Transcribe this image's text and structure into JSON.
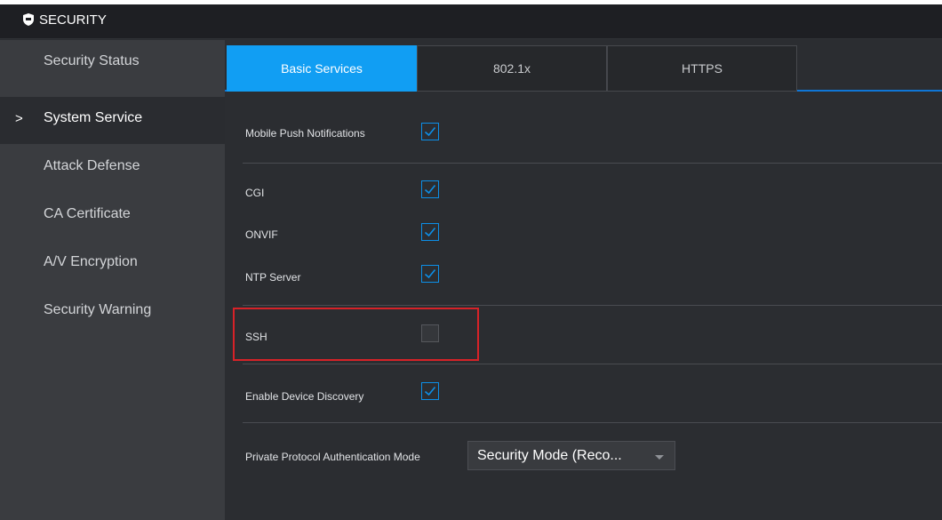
{
  "window": {
    "title": "SECURITY",
    "icon": "shield-icon"
  },
  "sidebar": {
    "items": [
      {
        "label": "Security Status"
      },
      {
        "label": "System Service",
        "active": true
      },
      {
        "label": "Attack Defense"
      },
      {
        "label": "CA Certificate"
      },
      {
        "label": "A/V Encryption"
      },
      {
        "label": "Security Warning"
      }
    ],
    "active_marker": ">"
  },
  "tabs": [
    {
      "label": "Basic Services",
      "active": true
    },
    {
      "label": "802.1x"
    },
    {
      "label": "HTTPS"
    }
  ],
  "settings": {
    "mobile_push": {
      "label": "Mobile Push Notifications",
      "checked": true
    },
    "cgi": {
      "label": "CGI",
      "checked": true
    },
    "onvif": {
      "label": "ONVIF",
      "checked": true
    },
    "ntp": {
      "label": "NTP Server",
      "checked": true
    },
    "ssh": {
      "label": "SSH",
      "checked": false
    },
    "discovery": {
      "label": "Enable Device Discovery",
      "checked": true
    },
    "auth_mode": {
      "label": "Private Protocol Authentication Mode",
      "value": "Security Mode (Reco..."
    }
  },
  "colors": {
    "accent": "#119ef3",
    "highlight_border": "#d72228",
    "sidebar_bg": "#3a3c40",
    "content_bg": "#2b2d31"
  }
}
